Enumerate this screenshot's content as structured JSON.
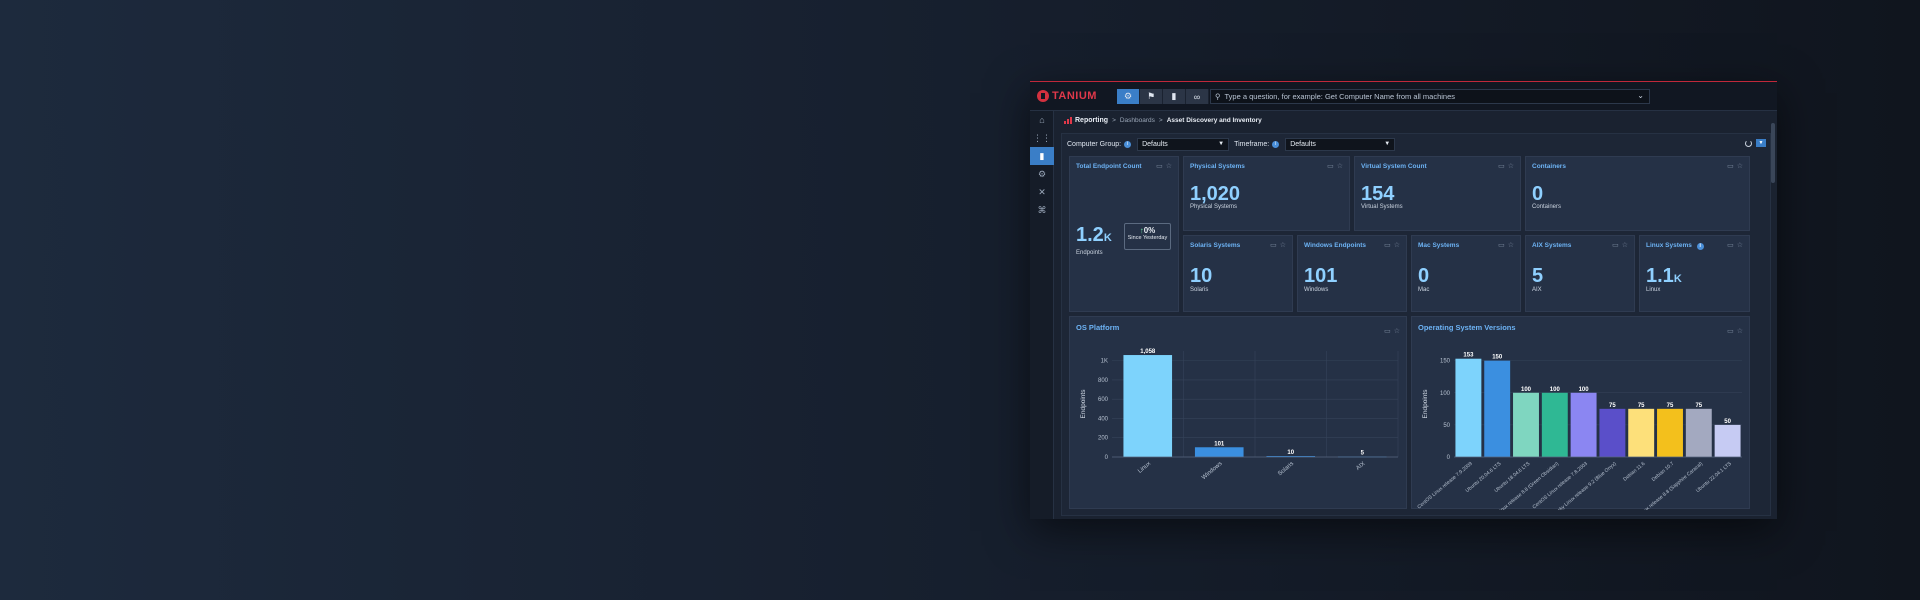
{
  "app": {
    "brand": "TANIUM",
    "search_placeholder": "Type a question, for example: Get Computer Name from all machines",
    "toolbar_icons": [
      "gear-icon",
      "flag-icon",
      "bar-chart-icon",
      "link-icon"
    ]
  },
  "sidenav": {
    "items": [
      "home-icon",
      "apps-grid-icon",
      "reporting-icon",
      "settings-icon",
      "tools-icon",
      "alerts-icon"
    ],
    "active": "reporting-icon"
  },
  "breadcrumb": {
    "root": "Reporting",
    "sep": ">",
    "level1": "Dashboards",
    "current": "Asset Discovery and Inventory"
  },
  "filters": {
    "computer_group_label": "Computer Group:",
    "computer_group_value": "Defaults",
    "timeframe_label": "Timeframe:",
    "timeframe_value": "Defaults"
  },
  "cards": {
    "total": {
      "title": "Total Endpoint Count",
      "value": "1.2",
      "unit": "K",
      "sub": "Endpoints",
      "delta_value": "0",
      "delta_pct": "%",
      "delta_label": "Since Yesterday"
    },
    "physical": {
      "title": "Physical Systems",
      "value": "1,020",
      "sub": "Physical Systems"
    },
    "virtual": {
      "title": "Virtual System Count",
      "value": "154",
      "sub": "Virtual Systems"
    },
    "containers": {
      "title": "Containers",
      "value": "0",
      "sub": "Containers"
    },
    "solaris": {
      "title": "Solaris Systems",
      "value": "10",
      "sub": "Solaris"
    },
    "windows": {
      "title": "Windows Endpoints",
      "value": "101",
      "sub": "Windows"
    },
    "mac": {
      "title": "Mac Systems",
      "value": "0",
      "sub": "Mac"
    },
    "aix": {
      "title": "AIX Systems",
      "value": "5",
      "sub": "AIX"
    },
    "linux": {
      "title": "Linux Systems",
      "value": "1.1",
      "unit": "K",
      "sub": "Linux"
    }
  },
  "chart_data": [
    {
      "type": "bar",
      "title": "OS Platform",
      "ylabel": "Endpoints",
      "categories": [
        "Linux",
        "Windows",
        "Solaris",
        "AIX"
      ],
      "values": [
        1058,
        101,
        10,
        5
      ],
      "value_labels": [
        "1,058",
        "101",
        "10",
        "5"
      ],
      "yticks": [
        0,
        200,
        400,
        600,
        800,
        1000
      ],
      "ytick_labels": [
        "0",
        "200",
        "400",
        "600",
        "800",
        "1K"
      ],
      "ylim": [
        0,
        1100
      ],
      "colors": [
        "#7dd3fc",
        "#3b8fe0",
        "#3b8fe0",
        "#3b8fe0"
      ],
      "grid": true
    },
    {
      "type": "bar",
      "title": "Operating System Versions",
      "ylabel": "Endpoints",
      "categories": [
        "CentOS Linux release 7.9.2009",
        "Ubuntu 20.04.6 LTS",
        "Ubuntu 18.04.6 LTS",
        "Rocky Linux release 8.8 (Green Obsidian)",
        "CentOS Linux release 7.8.2003",
        "Rocky Linux release 9.2 (Blue Onyx)",
        "Debian 11.6",
        "Debian 10.7",
        "AlmaLinux release 8.8 (Sapphire Caracal)",
        "Ubuntu 22.04.1 LTS"
      ],
      "values": [
        153,
        150,
        100,
        100,
        100,
        75,
        75,
        75,
        75,
        50
      ],
      "yticks": [
        0,
        50,
        100,
        150
      ],
      "ylim": [
        0,
        165
      ],
      "colors": [
        "#7dd3fc",
        "#3b8fe0",
        "#7fd6c0",
        "#2fb894",
        "#8b86f2",
        "#5a4fc9",
        "#fde07a",
        "#f3c01c",
        "#a3a9c0",
        "#c6cbf3"
      ],
      "grid": true
    }
  ]
}
